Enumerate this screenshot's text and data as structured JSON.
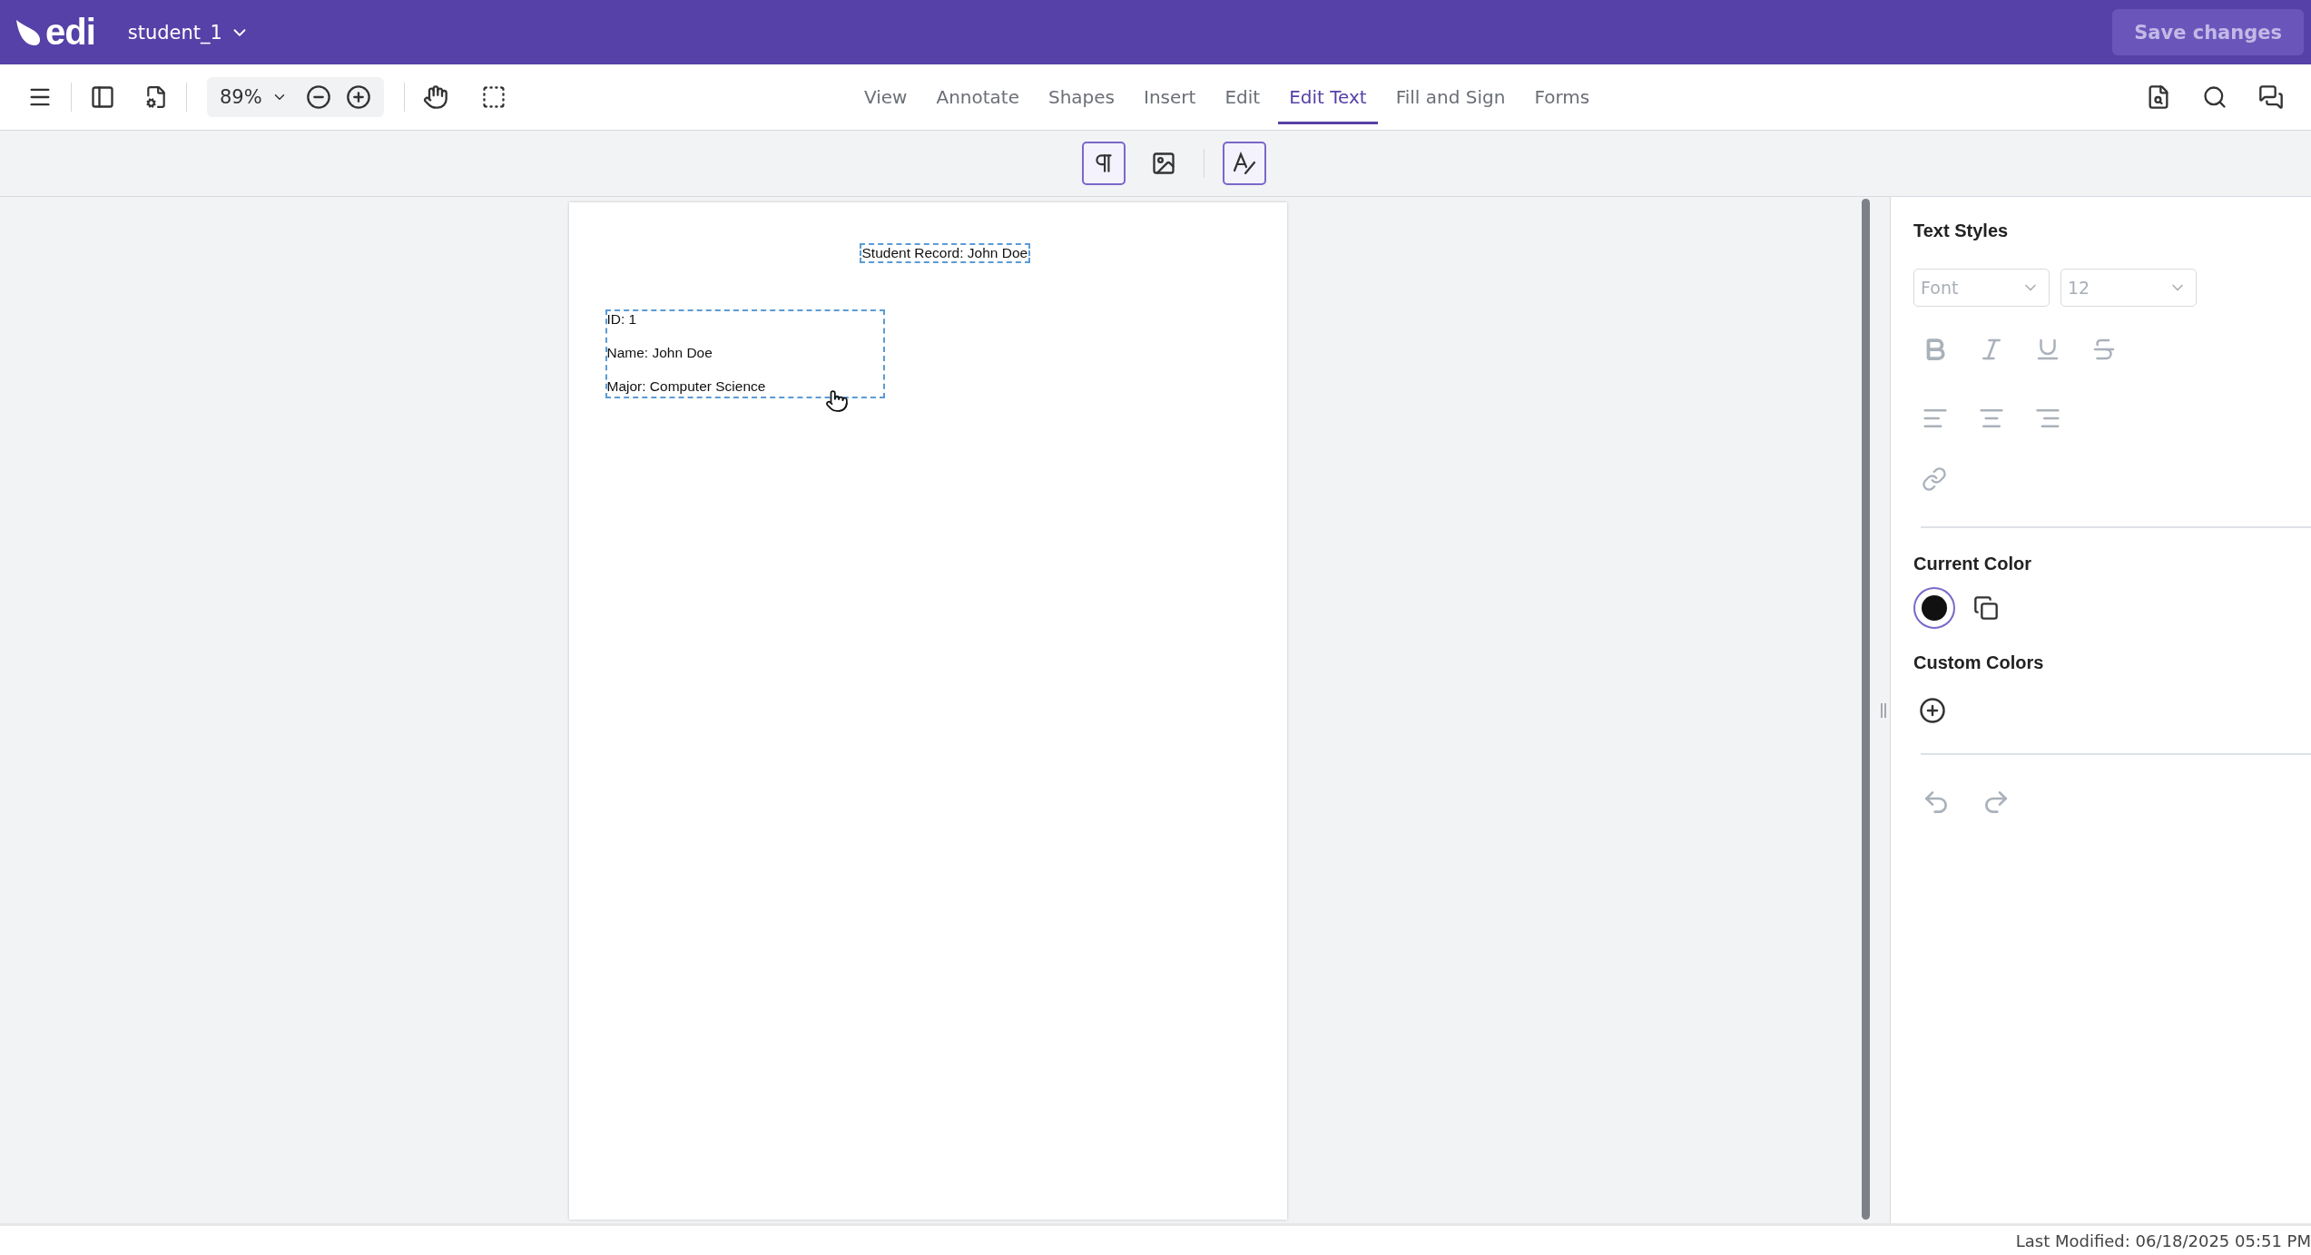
{
  "header": {
    "logo": "edi",
    "document_name": "student_1",
    "save_button": {
      "label": "Save changes",
      "disabled": true
    }
  },
  "toolbar": {
    "zoom": "89%",
    "tabs": [
      {
        "label": "View",
        "selected": false
      },
      {
        "label": "Annotate",
        "selected": false
      },
      {
        "label": "Shapes",
        "selected": false
      },
      {
        "label": "Insert",
        "selected": false
      },
      {
        "label": "Edit",
        "selected": false
      },
      {
        "label": "Edit Text",
        "selected": true
      },
      {
        "label": "Fill and Sign",
        "selected": false
      },
      {
        "label": "Forms",
        "selected": false
      }
    ]
  },
  "edit_tools": [
    {
      "kind": "paragraph",
      "selected": true
    },
    {
      "kind": "image",
      "selected": false
    },
    {
      "kind": "text-style",
      "selected": true
    }
  ],
  "document": {
    "title": "Student Record: John Doe",
    "lines": [
      "ID: 1",
      "Name: John Doe",
      "Major: Computer Science"
    ]
  },
  "panel": {
    "heading": "Text Styles",
    "font": {
      "placeholder": "Font"
    },
    "size": {
      "value": "12"
    },
    "formatting_disabled": true,
    "current_color": {
      "heading": "Current Color",
      "color": "#111111"
    },
    "custom_colors": {
      "heading": "Custom Colors"
    }
  },
  "status_bar": {
    "last_modified": "Last Modified: 06/18/2025 05:51 PM"
  }
}
